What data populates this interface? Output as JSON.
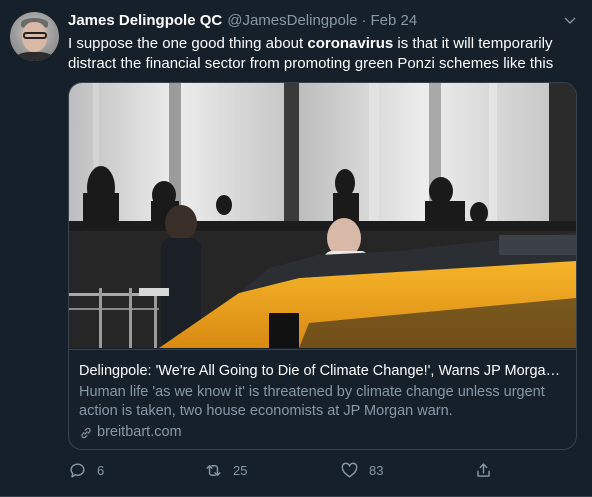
{
  "tweet": {
    "author_name": "James Delingpole QC",
    "handle": "@JamesDelingpole",
    "separator": "·",
    "date": "Feb 24",
    "text_before": "I suppose the one good thing about ",
    "text_bold": "coronavirus",
    "text_after": " is that it will temporarily distract the financial sector from promoting green Ponzi schemes like this"
  },
  "card": {
    "title": "Delingpole: 'We're All Going to Die of Climate Change!', Warns JP Morgan ...",
    "description": "Human life 'as we know it' is threatened by climate change unless urgent action is taken, two house economists at JP Morgan warn.",
    "domain": "breitbart.com",
    "image_icon": "photo-street-taxi"
  },
  "actions": {
    "reply_count": "6",
    "retweet_count": "25",
    "like_count": "83",
    "reply_icon": "reply-icon",
    "retweet_icon": "retweet-icon",
    "like_icon": "heart-icon",
    "share_icon": "share-icon"
  },
  "colors": {
    "background": "#15202b",
    "secondary_text": "#8899a6",
    "border": "#38444d",
    "taxi": "#f2a81d"
  }
}
